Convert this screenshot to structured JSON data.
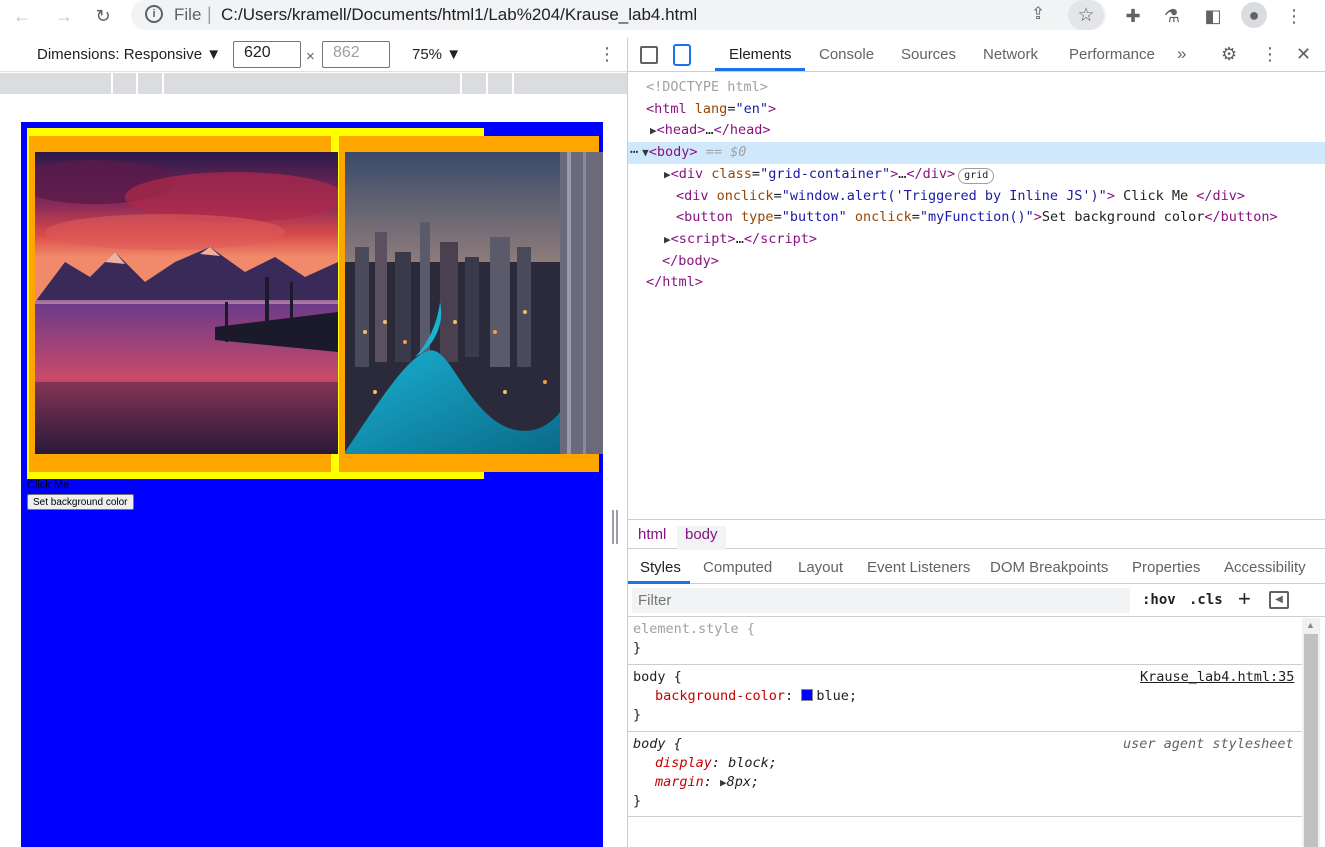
{
  "browser": {
    "file_label": "File",
    "url": "C:/Users/kramell/Documents/html1/Lab%204/Krause_lab4.html",
    "info_glyph": "i"
  },
  "device_toolbar": {
    "dimensions_label": "Dimensions: Responsive ▼",
    "width": "620",
    "height": "862",
    "times": "×",
    "zoom_label": "75% ▼",
    "more": "⋮"
  },
  "emulated_page": {
    "background_color": "#0000ff",
    "click_me_text": "Click Me",
    "button_label": "Set background color",
    "image1_alt": "mountain lake sunset",
    "image2_alt": "city skyline at night"
  },
  "devtools": {
    "tabs": [
      "Elements",
      "Console",
      "Sources",
      "Network",
      "Performance"
    ],
    "more_tabs": "»",
    "close": "✕",
    "dom": {
      "doctype": "<!DOCTYPE html>",
      "html_open_tag": "html",
      "html_lang_attr": "lang",
      "html_lang_val": "\"en\"",
      "head": "head",
      "ellipsis": "…",
      "body": "body",
      "selected_marker": "== $0",
      "div1_attr": "class",
      "div1_val": "\"grid-container\"",
      "grid_badge": "grid",
      "div2_attr": "onclick",
      "div2_val": "\"window.alert('Triggered by Inline JS')\"",
      "div2_text": " Click Me ",
      "button_attr1": "type",
      "button_val1": "\"button\"",
      "button_attr2": "onclick",
      "button_val2": "\"myFunction()\"",
      "button_text": "Set background color",
      "script": "script"
    },
    "breadcrumbs": [
      "html",
      "body"
    ],
    "sub_tabs": [
      "Styles",
      "Computed",
      "Layout",
      "Event Listeners",
      "DOM Breakpoints",
      "Properties",
      "Accessibility"
    ],
    "filter_placeholder": "Filter",
    "hov": ":hov",
    "cls": ".cls",
    "add": "+",
    "styles": {
      "element_style": "element.style {",
      "close_brace": "}",
      "body_selector": "body {",
      "body_source": "Krause_lab4.html:35",
      "bg_prop": "background-color",
      "bg_val": "blue;",
      "bg_swatch": "#0000ff",
      "ua_selector": "body {",
      "ua_source": "user agent stylesheet",
      "display_prop": "display",
      "display_val": "block;",
      "margin_prop": "margin",
      "margin_val": "8px;"
    }
  }
}
